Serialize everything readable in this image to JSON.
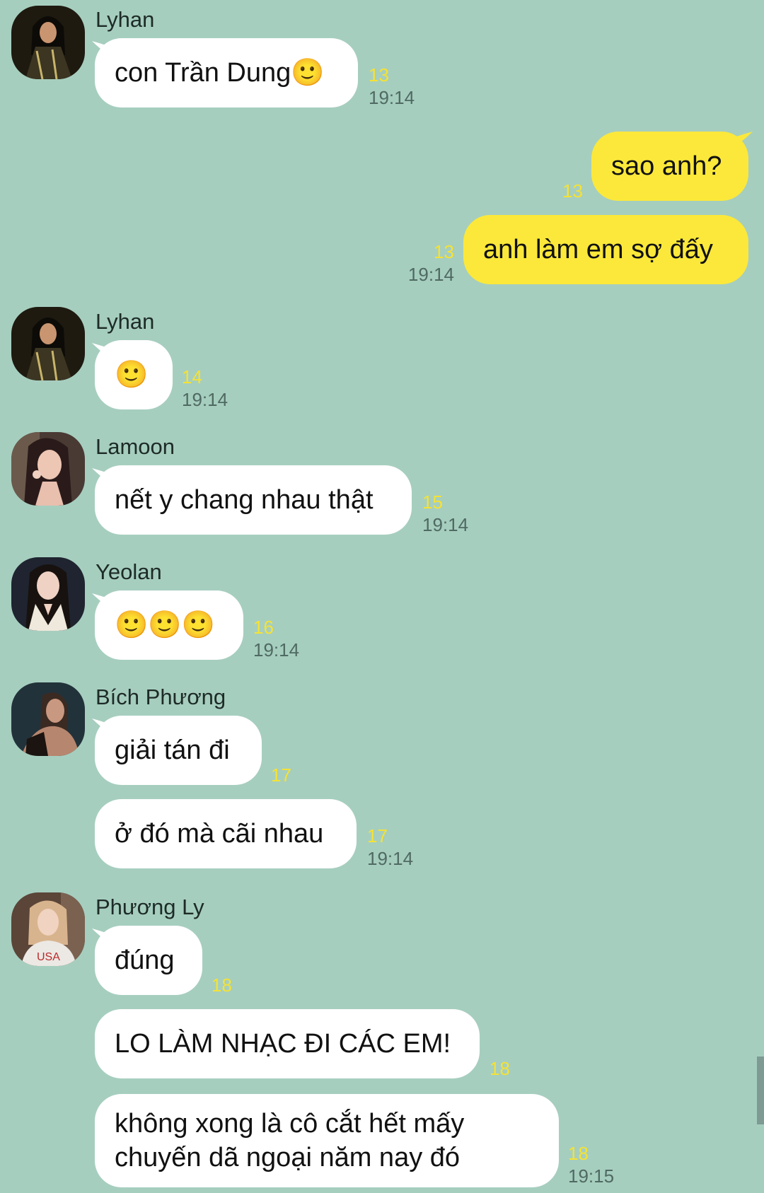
{
  "colors": {
    "background": "#a6cebf",
    "incoming_bubble": "#ffffff",
    "outgoing_bubble": "#fbe83a",
    "unread_count": "#f5e234"
  },
  "messages": [
    {
      "sender": "Lyhan",
      "text": "con Trần Dung🙂",
      "count": "13",
      "time": "19:14"
    },
    {
      "mine": true,
      "text": "sao anh?",
      "count": "13"
    },
    {
      "mine": true,
      "text": "anh làm em sợ đấy",
      "count": "13",
      "time": "19:14"
    },
    {
      "sender": "Lyhan",
      "text": "🙂",
      "count": "14",
      "time": "19:14"
    },
    {
      "sender": "Lamoon",
      "text": "nết y chang nhau thật",
      "count": "15",
      "time": "19:14"
    },
    {
      "sender": "Yeolan",
      "text": "🙂🙂🙂",
      "count": "16",
      "time": "19:14"
    },
    {
      "sender": "Bích Phương",
      "text": "giải tán đi",
      "count": "17"
    },
    {
      "text": "ở đó mà cãi nhau",
      "count": "17",
      "time": "19:14"
    },
    {
      "sender": "Phương Ly",
      "text": "đúng",
      "count": "18"
    },
    {
      "text": "LO LÀM NHẠC ĐI CÁC EM!",
      "count": "18"
    },
    {
      "text": "không xong là cô cắt hết mấy chuyến dã ngoại năm nay đó",
      "count": "18",
      "time": "19:15"
    }
  ]
}
